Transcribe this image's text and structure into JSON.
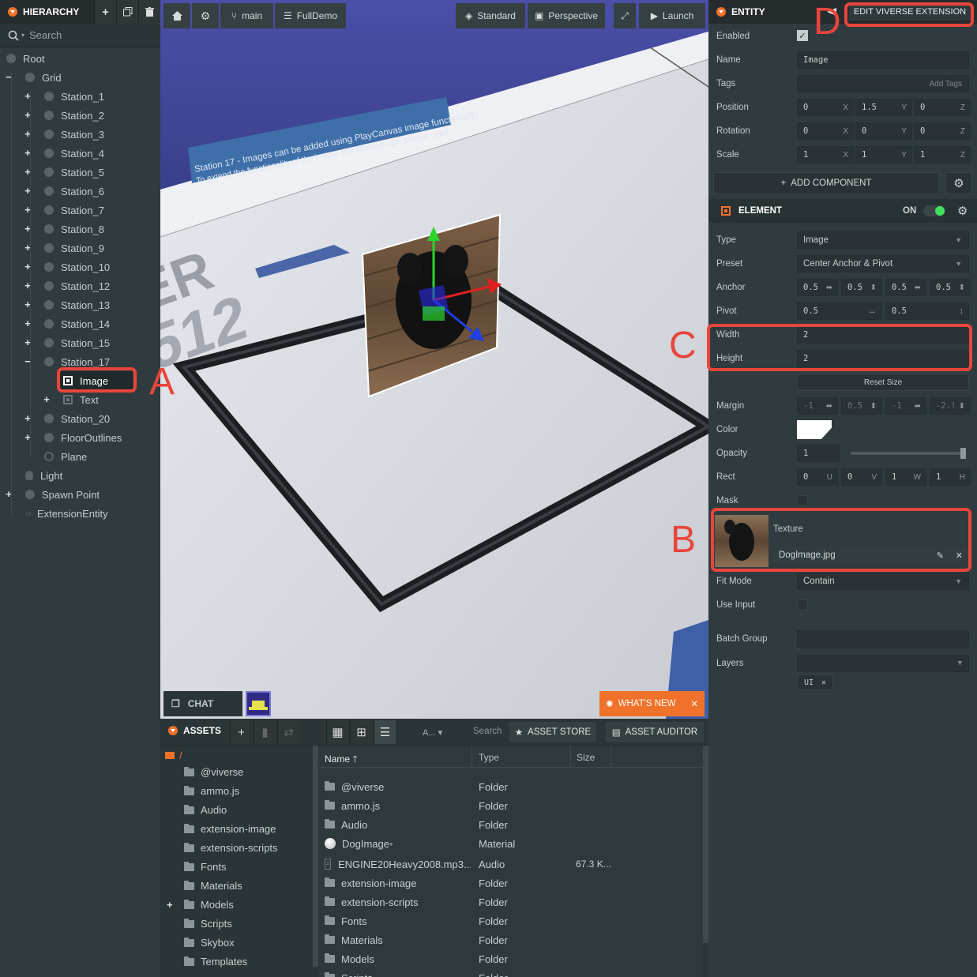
{
  "hierarchy": {
    "title": "HIERARCHY",
    "search_placeholder": "Search",
    "items": [
      {
        "label": "Root",
        "indent": 0,
        "expander": "",
        "icon": "entity"
      },
      {
        "label": "Grid",
        "indent": 1,
        "expander": "−",
        "icon": "entity"
      },
      {
        "label": "Station_1",
        "indent": 2,
        "expander": "+",
        "icon": "entity"
      },
      {
        "label": "Station_2",
        "indent": 2,
        "expander": "+",
        "icon": "entity"
      },
      {
        "label": "Station_3",
        "indent": 2,
        "expander": "+",
        "icon": "entity"
      },
      {
        "label": "Station_4",
        "indent": 2,
        "expander": "+",
        "icon": "entity"
      },
      {
        "label": "Station_5",
        "indent": 2,
        "expander": "+",
        "icon": "entity"
      },
      {
        "label": "Station_6",
        "indent": 2,
        "expander": "+",
        "icon": "entity"
      },
      {
        "label": "Station_7",
        "indent": 2,
        "expander": "+",
        "icon": "entity"
      },
      {
        "label": "Station_8",
        "indent": 2,
        "expander": "+",
        "icon": "entity"
      },
      {
        "label": "Station_9",
        "indent": 2,
        "expander": "+",
        "icon": "entity"
      },
      {
        "label": "Station_10",
        "indent": 2,
        "expander": "+",
        "icon": "entity"
      },
      {
        "label": "Station_12",
        "indent": 2,
        "expander": "+",
        "icon": "entity"
      },
      {
        "label": "Station_13",
        "indent": 2,
        "expander": "+",
        "icon": "entity"
      },
      {
        "label": "Station_14",
        "indent": 2,
        "expander": "+",
        "icon": "entity"
      },
      {
        "label": "Station_15",
        "indent": 2,
        "expander": "+",
        "icon": "entity"
      },
      {
        "label": "Station_17",
        "indent": 2,
        "expander": "−",
        "icon": "entity"
      },
      {
        "label": "Image",
        "indent": 3,
        "expander": "",
        "icon": "element",
        "selected": true
      },
      {
        "label": "Text",
        "indent": 3,
        "expander": "+",
        "icon": "element"
      },
      {
        "label": "Station_20",
        "indent": 2,
        "expander": "+",
        "icon": "entity"
      },
      {
        "label": "FloorOutlines",
        "indent": 2,
        "expander": "+",
        "icon": "entity"
      },
      {
        "label": "Plane",
        "indent": 2,
        "expander": "",
        "icon": "plane"
      },
      {
        "label": "Light",
        "indent": 1,
        "expander": "",
        "icon": "light"
      },
      {
        "label": "Spawn Point",
        "indent": 1,
        "expander": "+",
        "icon": "entity"
      },
      {
        "label": "ExtensionEntity",
        "indent": 1,
        "expander": "",
        "icon": "code"
      }
    ]
  },
  "toolbar": {
    "branch": "main",
    "scene": "FullDemo",
    "standard": "Standard",
    "perspective": "Perspective",
    "launch": "Launch"
  },
  "viewport": {
    "banner_line1": "Station 17 - Images can be added using PlayCanvas image functionality",
    "banner_line2": "To extend the functionality of the image, the Media plugin can be used.",
    "floor_text1": "ER",
    "floor_text2": "512",
    "chat": "CHAT",
    "whats_new": "WHAT'S NEW"
  },
  "inspector": {
    "entity_title": "ENTITY",
    "edit_ext": "EDIT VIVERSE EXTENSION",
    "enabled_label": "Enabled",
    "name_label": "Name",
    "name_value": "Image",
    "tags_label": "Tags",
    "tags_placeholder": "Add Tags",
    "position_label": "Position",
    "position": [
      "0",
      "1.5",
      "0"
    ],
    "rotation_label": "Rotation",
    "rotation": [
      "0",
      "0",
      "0"
    ],
    "scale_label": "Scale",
    "scale": [
      "1",
      "1",
      "1"
    ],
    "axes": [
      "X",
      "Y",
      "Z"
    ],
    "add_component": "ADD COMPONENT",
    "element_title": "ELEMENT",
    "on_label": "ON",
    "type_label": "Type",
    "type_value": "Image",
    "preset_label": "Preset",
    "preset_value": "Center Anchor & Pivot",
    "anchor_label": "Anchor",
    "anchor": [
      "0.5",
      "0.5",
      "0.5",
      "0.5"
    ],
    "pivot_label": "Pivot",
    "pivot": [
      "0.5",
      "0.5"
    ],
    "width_label": "Width",
    "width_value": "2",
    "height_label": "Height",
    "height_value": "2",
    "reset_size": "Reset Size",
    "margin_label": "Margin",
    "margin": [
      "-1",
      "0.5",
      "-1",
      "-2.!"
    ],
    "color_label": "Color",
    "opacity_label": "Opacity",
    "opacity_value": "1",
    "rect_label": "Rect",
    "rect": [
      "0",
      "0",
      "1",
      "1"
    ],
    "rect_axes": [
      "U",
      "V",
      "W",
      "H"
    ],
    "mask_label": "Mask",
    "texture_label": "Texture",
    "texture_value": "DogImage.jpg",
    "fit_mode_label": "Fit Mode",
    "fit_mode_value": "Contain",
    "use_input_label": "Use Input",
    "batch_group_label": "Batch Group",
    "layers_label": "Layers",
    "layer_tag": "UI"
  },
  "annotations": {
    "a": "A",
    "b": "B",
    "c": "C",
    "d": "D"
  },
  "assets": {
    "title": "ASSETS",
    "filter": "A...",
    "search": "Search",
    "asset_store": "ASSET STORE",
    "asset_auditor": "ASSET AUDITOR",
    "root_folder": "/",
    "folders": [
      "@viverse",
      "ammo.js",
      "Audio",
      "extension-image",
      "extension-scripts",
      "Fonts",
      "Materials",
      "Models",
      "Scripts",
      "Skybox",
      "Templates"
    ],
    "columns": [
      "Name",
      "Type",
      "Size"
    ],
    "rows": [
      {
        "name": "@viverse",
        "type": "Folder",
        "size": "",
        "icon": "folder"
      },
      {
        "name": "ammo.js",
        "type": "Folder",
        "size": "",
        "icon": "folder"
      },
      {
        "name": "Audio",
        "type": "Folder",
        "size": "",
        "icon": "folder"
      },
      {
        "name": "DogImage",
        "type": "Material",
        "size": "",
        "icon": "material"
      },
      {
        "name": "ENGINE20Heavy2008.mp3...",
        "type": "Audio",
        "size": "67.3 K...",
        "icon": "audio"
      },
      {
        "name": "extension-image",
        "type": "Folder",
        "size": "",
        "icon": "folder"
      },
      {
        "name": "extension-scripts",
        "type": "Folder",
        "size": "",
        "icon": "folder"
      },
      {
        "name": "Fonts",
        "type": "Folder",
        "size": "",
        "icon": "folder"
      },
      {
        "name": "Materials",
        "type": "Folder",
        "size": "",
        "icon": "folder"
      },
      {
        "name": "Models",
        "type": "Folder",
        "size": "",
        "icon": "folder"
      },
      {
        "name": "Scripts",
        "type": "Folder",
        "size": "",
        "icon": "folder"
      }
    ]
  },
  "colors": {
    "accent": "#f0722a",
    "annotation": "#e8453c",
    "toggle_on": "#3ee05e"
  }
}
